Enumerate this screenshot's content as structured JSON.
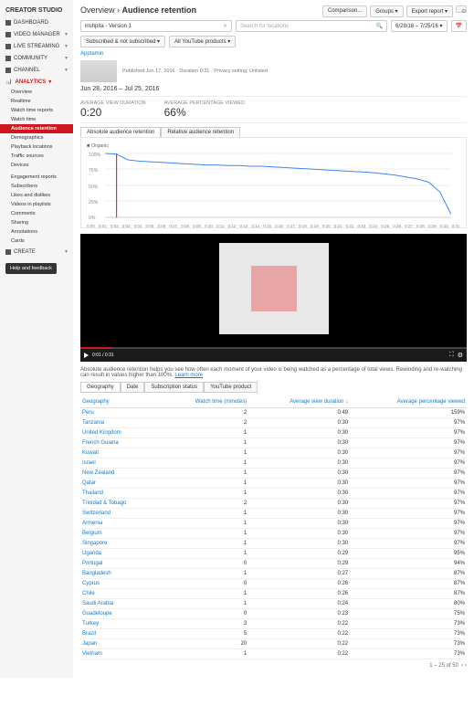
{
  "sidebar": {
    "header": "CREATOR STUDIO",
    "sections": [
      {
        "label": "DASHBOARD"
      },
      {
        "label": "VIDEO MANAGER"
      },
      {
        "label": "LIVE STREAMING"
      },
      {
        "label": "COMMUNITY"
      },
      {
        "label": "CHANNEL"
      }
    ],
    "analytics_label": "ANALYTICS",
    "analytics_items": [
      "Overview",
      "Realtime",
      "Watch time reports",
      "Watch time",
      "Audience retention",
      "Demographics",
      "Playback locations",
      "Traffic sources",
      "Devices",
      "",
      "Engagement reports",
      "Subscribers",
      "Likes and dislikes",
      "Videos in playlists",
      "Comments",
      "Sharing",
      "Annotations",
      "Cards"
    ],
    "create_label": "CREATE",
    "help_label": "Help and feedback"
  },
  "header": {
    "breadcrumb_root": "Overview",
    "breadcrumb_current": "Audience retention",
    "buttons": {
      "comparison": "Comparison...",
      "groups": "Groups",
      "export": "Export report"
    }
  },
  "filters": {
    "video_filter": "irishpita - Version 1",
    "location_placeholder": "Search for locations",
    "date_range": "6/28/16 – 7/25/16",
    "subscribed": "Subscribed & not subscribed",
    "products": "All YouTube products"
  },
  "video": {
    "channel": "Apptamin",
    "meta": "Published Jun 17, 2016 · Duration 0:31 · Privacy setting: Unlisted",
    "date_range_text": "Jun 28, 2016 – Jul 25, 2016"
  },
  "metrics": {
    "avd_label": "AVERAGE VIEW DURATION",
    "avd_value": "0:20",
    "apv_label": "AVERAGE PERCENTAGE VIEWED",
    "apv_value": "66%"
  },
  "chart_tabs": {
    "abs": "Absolute audience retention",
    "rel": "Relative audience retention"
  },
  "chart_legend": "Organic",
  "chart_data": {
    "type": "line",
    "title": "",
    "xlabel": "",
    "ylabel": "",
    "ylim": [
      0,
      100
    ],
    "y_ticks": [
      "100%",
      "75%",
      "50%",
      "25%",
      "0%"
    ],
    "x_ticks": [
      "0:00",
      "0:01",
      "0:02",
      "0:03",
      "0:04",
      "0:05",
      "0:06",
      "0:07",
      "0:08",
      "0:09",
      "0:10",
      "0:11",
      "0:12",
      "0:13",
      "0:14",
      "0:15",
      "0:16",
      "0:17",
      "0:18",
      "0:19",
      "0:20",
      "0:21",
      "0:22",
      "0:23",
      "0:24",
      "0:25",
      "0:26",
      "0:27",
      "0:28",
      "0:29",
      "0:30",
      "0:31"
    ],
    "marker_at": "0:01",
    "series": [
      {
        "name": "Organic",
        "color": "#4285f4",
        "values": [
          100,
          99,
          90,
          88,
          87,
          86,
          85,
          84,
          83,
          82,
          82,
          81,
          81,
          80,
          80,
          79,
          78,
          77,
          76,
          75,
          74,
          73,
          72,
          71,
          70,
          68,
          66,
          63,
          60,
          55,
          40,
          5
        ]
      }
    ]
  },
  "player": {
    "time": "0:01 / 0:31"
  },
  "description": {
    "text": "Absolute audience retention helps you see how often each moment of your video is being watched as a percentage of total views. Rewinding and re-watching can result in values higher than 100%.",
    "learn_more": "Learn more"
  },
  "sub_tabs": [
    "Geography",
    "Date",
    "Subscription status",
    "YouTube product"
  ],
  "table": {
    "headers": {
      "geo": "Geography",
      "watch": "Watch time (minutes)",
      "avd": "Average view duration",
      "apv": "Average percentage viewed"
    },
    "rows": [
      {
        "geo": "Peru",
        "watch": 2,
        "avd": "0:49",
        "apv": "159%"
      },
      {
        "geo": "Tanzania",
        "watch": 2,
        "avd": "0:30",
        "apv": "97%"
      },
      {
        "geo": "United Kingdom",
        "watch": 1,
        "avd": "0:30",
        "apv": "97%"
      },
      {
        "geo": "French Guiana",
        "watch": 1,
        "avd": "0:30",
        "apv": "97%"
      },
      {
        "geo": "Kuwait",
        "watch": 1,
        "avd": "0:30",
        "apv": "97%"
      },
      {
        "geo": "Israel",
        "watch": 1,
        "avd": "0:30",
        "apv": "97%"
      },
      {
        "geo": "New Zealand",
        "watch": 1,
        "avd": "0:30",
        "apv": "97%"
      },
      {
        "geo": "Qatar",
        "watch": 1,
        "avd": "0:30",
        "apv": "97%"
      },
      {
        "geo": "Thailand",
        "watch": 1,
        "avd": "0:30",
        "apv": "97%"
      },
      {
        "geo": "Trinidad & Tobago",
        "watch": 2,
        "avd": "0:30",
        "apv": "97%"
      },
      {
        "geo": "Switzerland",
        "watch": 1,
        "avd": "0:30",
        "apv": "97%"
      },
      {
        "geo": "Armenia",
        "watch": 1,
        "avd": "0:30",
        "apv": "97%"
      },
      {
        "geo": "Belgium",
        "watch": 1,
        "avd": "0:30",
        "apv": "97%"
      },
      {
        "geo": "Singapore",
        "watch": 1,
        "avd": "0:30",
        "apv": "97%"
      },
      {
        "geo": "Uganda",
        "watch": 1,
        "avd": "0:29",
        "apv": "95%"
      },
      {
        "geo": "Portugal",
        "watch": 0,
        "avd": "0:29",
        "apv": "94%"
      },
      {
        "geo": "Bangladesh",
        "watch": 1,
        "avd": "0:27",
        "apv": "87%"
      },
      {
        "geo": "Cyprus",
        "watch": 0,
        "avd": "0:26",
        "apv": "87%"
      },
      {
        "geo": "Chile",
        "watch": 1,
        "avd": "0:26",
        "apv": "87%"
      },
      {
        "geo": "Saudi Arabia",
        "watch": 1,
        "avd": "0:24",
        "apv": "80%"
      },
      {
        "geo": "Guadeloupe",
        "watch": 0,
        "avd": "0:23",
        "apv": "75%"
      },
      {
        "geo": "Turkey",
        "watch": 3,
        "avd": "0:22",
        "apv": "73%"
      },
      {
        "geo": "Brazil",
        "watch": 5,
        "avd": "0:22",
        "apv": "73%"
      },
      {
        "geo": "Japan",
        "watch": 20,
        "avd": "0:22",
        "apv": "73%"
      },
      {
        "geo": "Vietnam",
        "watch": 1,
        "avd": "0:22",
        "apv": "73%"
      }
    ],
    "pager": "1 – 25 of  50"
  }
}
